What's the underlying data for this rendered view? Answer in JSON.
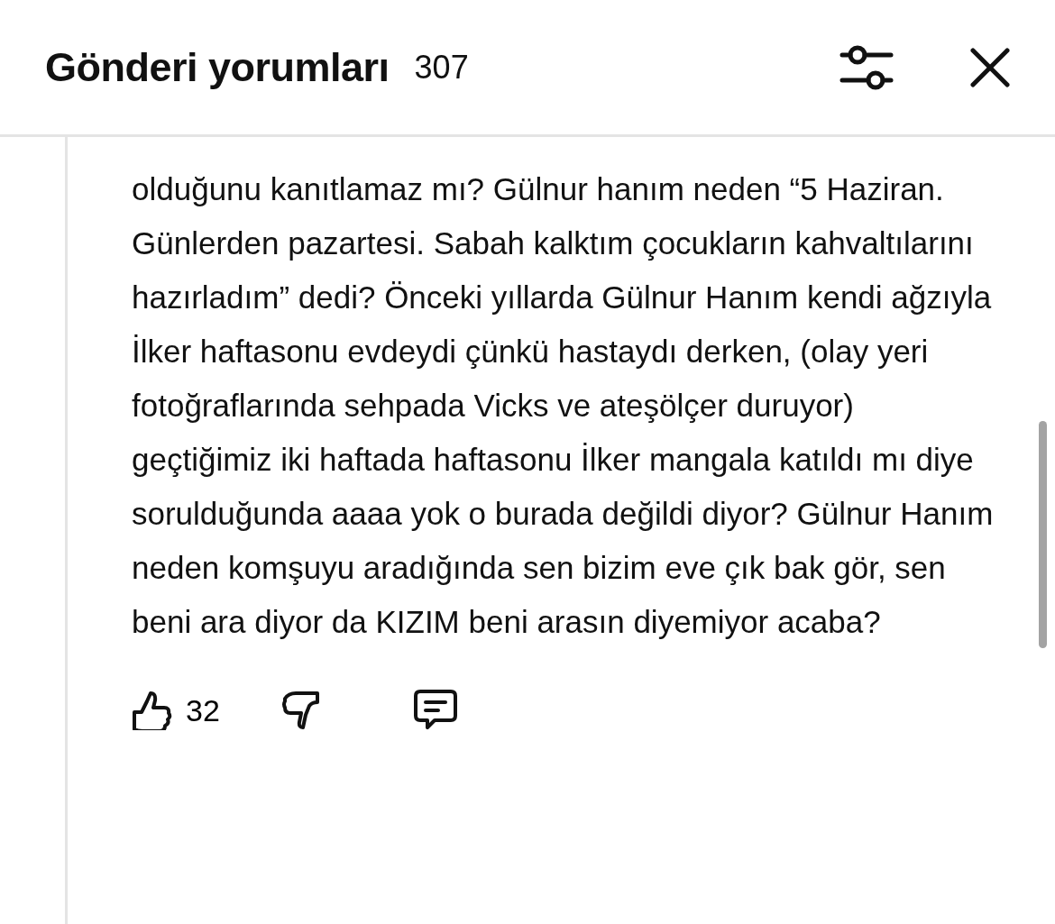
{
  "header": {
    "title": "Gönderi yorumları",
    "count": "307"
  },
  "comment": {
    "text": "olduğunu kanıtlamaz mı? Gülnur hanım neden “5 Haziran. Günlerden pazartesi. Sabah kalktım çocukların kahvaltılarını hazırladım” dedi? Önceki yıllarda Gülnur Hanım kendi ağzıyla İlker haftasonu evdeydi çünkü hastaydı derken, (olay yeri fotoğraflarında sehpada Vicks ve ateşölçer duruyor) geçtiğimiz iki haftada haftasonu İlker mangala katıldı mı diye sorulduğunda aaaa yok o burada değildi diyor? Gülnur Hanım neden komşuyu aradığında sen bizim eve çık bak gör, sen beni ara diyor da KIZIM beni arasın diyemiyor acaba?",
    "likes": "32"
  }
}
